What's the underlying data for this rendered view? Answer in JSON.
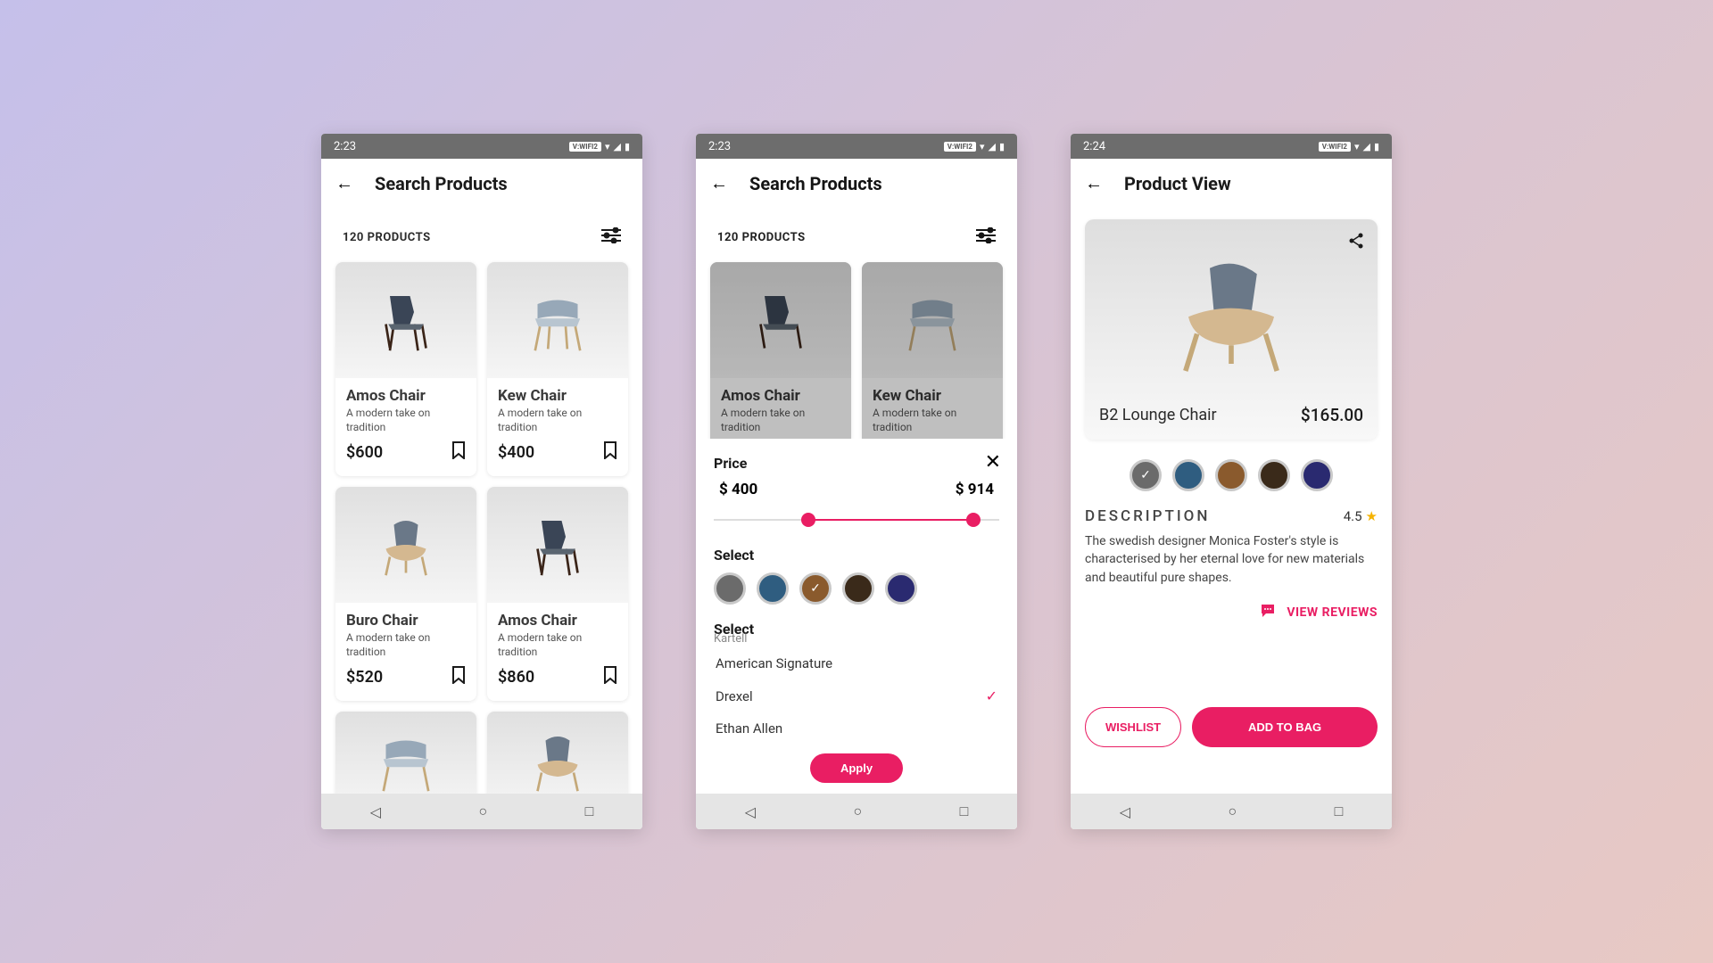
{
  "status": {
    "time1": "2:23",
    "time2": "2:23",
    "time3": "2:24",
    "wifi": "V:WIFI2"
  },
  "screen1": {
    "title": "Search Products",
    "count": "120 PRODUCTS",
    "products": [
      {
        "name": "Amos Chair",
        "desc": "A modern take on tradition",
        "price": "$600"
      },
      {
        "name": "Kew Chair",
        "desc": "A modern take on tradition",
        "price": "$400"
      },
      {
        "name": "Buro Chair",
        "desc": "A modern take on tradition",
        "price": "$520"
      },
      {
        "name": "Amos Chair",
        "desc": "A modern take on tradition",
        "price": "$860"
      }
    ]
  },
  "screen2": {
    "title": "Search Products",
    "count": "120 PRODUCTS",
    "products": [
      {
        "name": "Amos Chair",
        "desc": "A modern take on tradition",
        "price": "$600"
      },
      {
        "name": "Kew Chair",
        "desc": "A modern take on tradition",
        "price": "$400"
      }
    ],
    "filter": {
      "price_label": "Price",
      "min": "$ 400",
      "max": "$ 914",
      "color_label": "Select",
      "colors": [
        "#6b6b6b",
        "#2f5d80",
        "#8a5a2d",
        "#3a2a1a",
        "#2a2a70"
      ],
      "selected_color_index": 2,
      "brand_label": "Select",
      "brand_cut": "Kartell",
      "brands": [
        "American Signature",
        "Drexel",
        "Ethan Allen"
      ],
      "selected_brand_index": 1,
      "apply": "Apply"
    }
  },
  "screen3": {
    "title": "Product View",
    "name": "B2 Lounge Chair",
    "price": "$165.00",
    "colors": [
      "#6b6b6b",
      "#2f5d80",
      "#8a5a2d",
      "#3a2a1a",
      "#2a2a70"
    ],
    "selected_color_index": 0,
    "desc_title": "DESCRIPTION",
    "rating": "4.5",
    "desc": "The swedish designer Monica Foster's style is characterised by her eternal love for new materials and beautiful pure shapes.",
    "reviews": "VIEW REVIEWS",
    "wishlist": "WISHLIST",
    "addbag": "ADD TO BAG"
  }
}
